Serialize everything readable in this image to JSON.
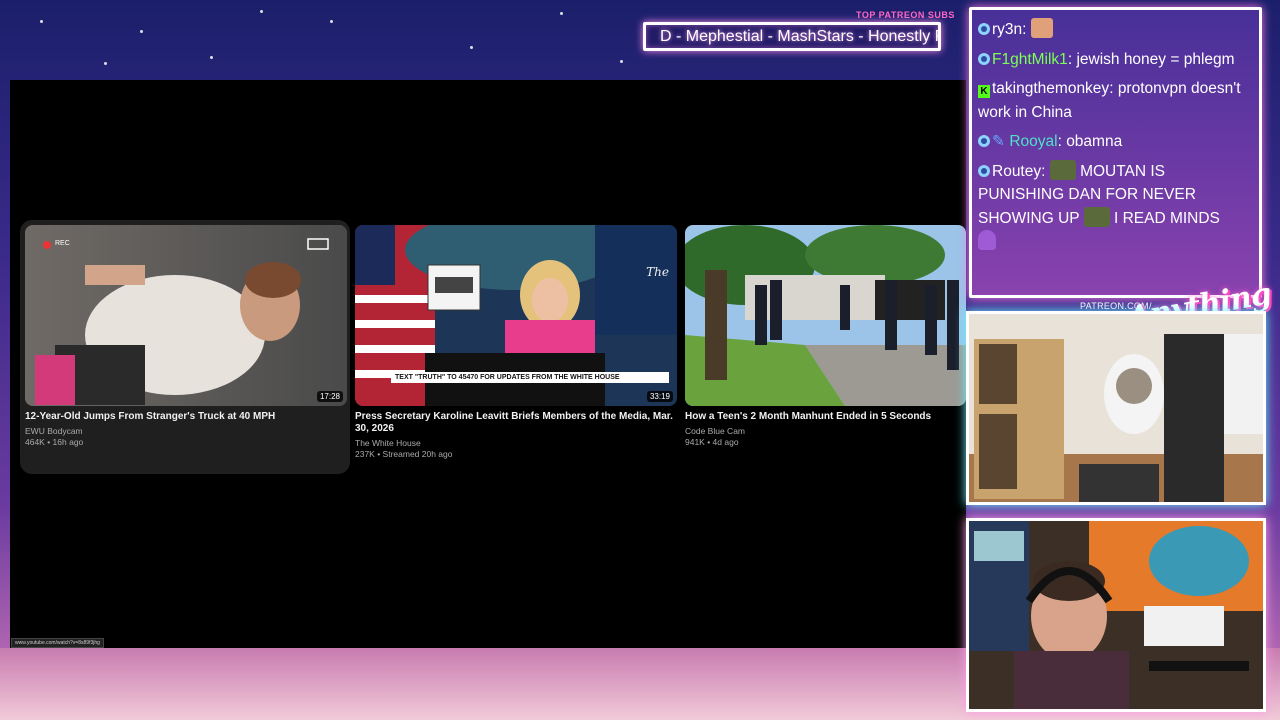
{
  "patreon": {
    "label": "TOP PATREON SUBS",
    "ticker": "D - Mephestial - MashStars - Honestly Rec"
  },
  "videos": [
    {
      "title": "12-Year-Old Jumps From Stranger's Truck at 40 MPH",
      "channel": "EWU Bodycam",
      "meta": "464K • 16h ago",
      "duration": "17:28",
      "thumb_text": "REC"
    },
    {
      "title": "Press Secretary Karoline Leavitt Briefs Members of the Media, Mar. 30, 2026",
      "channel": "The White House",
      "meta": "237K • Streamed 20h ago",
      "duration": "33:19",
      "thumb_banner": "TEXT \"TRUTH\" TO 45470 FOR UPDATES FROM THE WHITE HOUSE",
      "thumb_sign": "THE WHITE HOUSE"
    },
    {
      "title": "How a Teen's 2 Month Manhunt Ended in 5 Seconds",
      "channel": "Code Blue Cam",
      "meta": "941K • 4d ago",
      "duration": ""
    }
  ],
  "status_url": "www.youtube.com/watch?v=8s89f3jhg",
  "chat": [
    {
      "user": "ry3n",
      "text": ""
    },
    {
      "user": "F1ghtMilk1",
      "text": "jewish honey = phlegm"
    },
    {
      "user": "takingthemonkey",
      "text": "protonvpn doesn't work in China"
    },
    {
      "user": "Rooyal",
      "text": "obamna"
    },
    {
      "user": "Routey",
      "text_a": "MOUTAN IS PUNISHING DAN FOR NEVER SHOWING UP",
      "text_b": "I READ MINDS"
    }
  ],
  "overlay": {
    "patreon_url": "PATREON.COM/",
    "brand": "Anything Else?"
  },
  "colors": {
    "chat_green": "#7cff55",
    "chat_teal": "#4fe0c8",
    "accent_pink": "#ff66c4"
  }
}
